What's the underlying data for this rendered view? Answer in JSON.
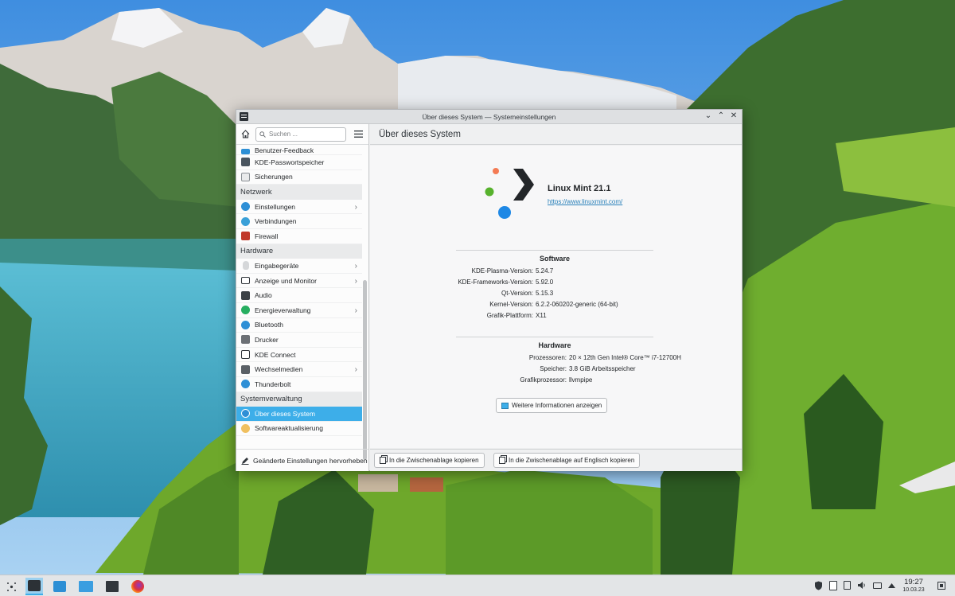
{
  "window": {
    "title": "Über dieses System — Systemeinstellungen"
  },
  "sidebar": {
    "search_placeholder": "Suchen ...",
    "items": [
      {
        "label": "Benutzer-Feedback",
        "kind": "item"
      },
      {
        "label": "KDE-Passwortspeicher",
        "kind": "item"
      },
      {
        "label": "Sicherungen",
        "kind": "item"
      },
      {
        "label": "Netzwerk",
        "kind": "category"
      },
      {
        "label": "Einstellungen",
        "kind": "item",
        "chevron": true
      },
      {
        "label": "Verbindungen",
        "kind": "item"
      },
      {
        "label": "Firewall",
        "kind": "item"
      },
      {
        "label": "Hardware",
        "kind": "category"
      },
      {
        "label": "Eingabegeräte",
        "kind": "item",
        "chevron": true
      },
      {
        "label": "Anzeige und Monitor",
        "kind": "item",
        "chevron": true
      },
      {
        "label": "Audio",
        "kind": "item"
      },
      {
        "label": "Energieverwaltung",
        "kind": "item",
        "chevron": true
      },
      {
        "label": "Bluetooth",
        "kind": "item"
      },
      {
        "label": "Drucker",
        "kind": "item"
      },
      {
        "label": "KDE Connect",
        "kind": "item"
      },
      {
        "label": "Wechselmedien",
        "kind": "item",
        "chevron": true
      },
      {
        "label": "Thunderbolt",
        "kind": "item"
      },
      {
        "label": "Systemverwaltung",
        "kind": "category"
      },
      {
        "label": "Über dieses System",
        "kind": "item",
        "selected": true
      },
      {
        "label": "Softwareaktualisierung",
        "kind": "item"
      }
    ],
    "footer_label": "Geänderte Einstellungen hervorheben"
  },
  "main": {
    "header": "Über dieses System",
    "distro_name": "Linux Mint 21.1",
    "distro_url": "https://www.linuxmint.com/",
    "software": {
      "title": "Software",
      "rows": [
        {
          "key": "KDE-Plasma-Version:",
          "value": "5.24.7"
        },
        {
          "key": "KDE-Frameworks-Version:",
          "value": "5.92.0"
        },
        {
          "key": "Qt-Version:",
          "value": "5.15.3"
        },
        {
          "key": "Kernel-Version:",
          "value": "6.2.2-060202-generic (64-bit)"
        },
        {
          "key": "Grafik-Plattform:",
          "value": "X11"
        }
      ]
    },
    "hardware": {
      "title": "Hardware",
      "rows": [
        {
          "key": "Prozessoren:",
          "value": "20 × 12th Gen Intel® Core™ i7-12700H"
        },
        {
          "key": "Speicher:",
          "value": "3.8 GiB Arbeitsspeicher"
        },
        {
          "key": "Grafikprozessor:",
          "value": "llvmpipe"
        }
      ]
    },
    "more_info_button": "Weitere Informationen anzeigen",
    "copy_button": "In die Zwischenablage kopieren",
    "copy_english_button": "In die Zwischenablage auf Englisch kopieren"
  },
  "taskbar": {
    "time": "19:27",
    "date": "10.03.23"
  },
  "colors": {
    "accent": "#3daee9",
    "mint_logo_orange": "#f47b54",
    "mint_logo_green": "#57b22d",
    "mint_logo_blue": "#1e88e5"
  }
}
